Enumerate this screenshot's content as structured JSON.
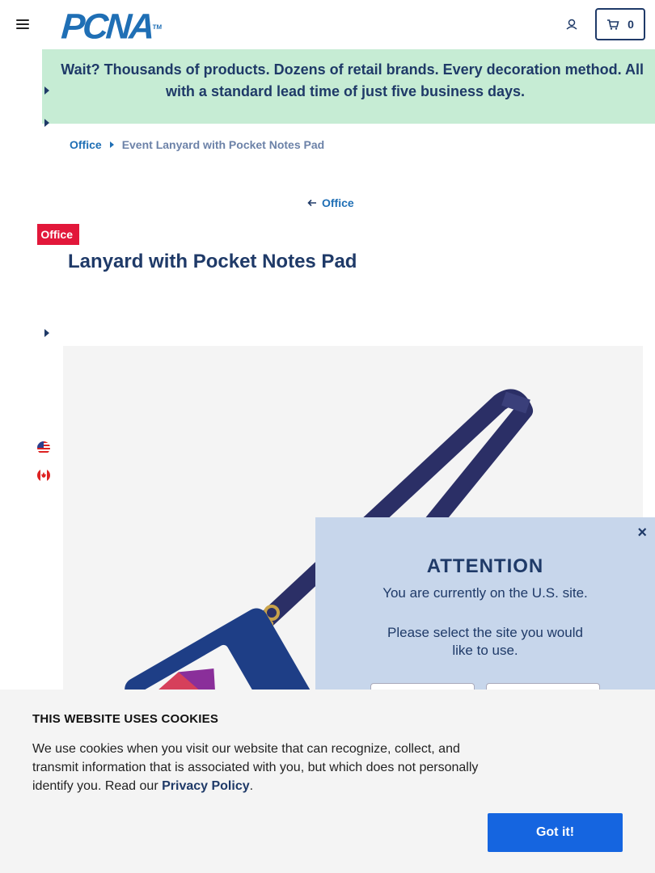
{
  "header": {
    "logo_text": "PCNA",
    "logo_tm": "TM",
    "cart_count": "0"
  },
  "banner": {
    "line1": "Wait? Thousands of products. Dozens of retail brands. Every decoration method. All",
    "line2": "with a standard lead time of just five business days."
  },
  "breadcrumb": {
    "parent": "Office",
    "current": "Event Lanyard with Pocket Notes Pad"
  },
  "back_link": "Office",
  "product": {
    "tag": "Office",
    "title": "Event Lanyard with Pocket Notes Pad"
  },
  "attention": {
    "close": "×",
    "title": "ATTENTION",
    "line1": "You are currently on the U.S. site.",
    "line2": "Please select the site you would like to use."
  },
  "cookie": {
    "title": "THIS WEBSITE USES COOKIES",
    "text": "We use cookies when you visit our website that can recognize, collect, and transmit information that is associated with you, but which does not personally identify you. Read our ",
    "link": "Privacy Policy",
    "period": ".",
    "button": "Got it!"
  },
  "colors": {
    "brand_blue": "#1f6fb5",
    "navy": "#1f3a68",
    "banner_green": "#c6ecd4",
    "tag_red": "#e2173a",
    "popup_blue": "#c7d6eb",
    "button_blue": "#1565e0"
  },
  "icons": [
    "menu-icon",
    "account-icon",
    "cart-icon",
    "caret-right-icon",
    "us-flag-icon",
    "canada-flag-icon",
    "arrow-left-icon",
    "close-icon"
  ]
}
